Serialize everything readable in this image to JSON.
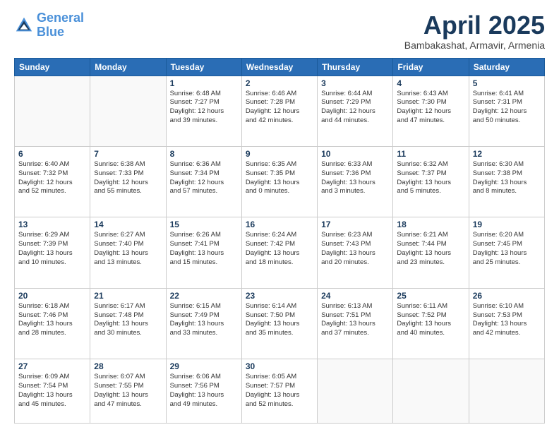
{
  "header": {
    "logo_line1": "General",
    "logo_line2": "Blue",
    "month": "April 2025",
    "location": "Bambakashat, Armavir, Armenia"
  },
  "weekdays": [
    "Sunday",
    "Monday",
    "Tuesday",
    "Wednesday",
    "Thursday",
    "Friday",
    "Saturday"
  ],
  "weeks": [
    [
      {
        "day": "",
        "text": ""
      },
      {
        "day": "",
        "text": ""
      },
      {
        "day": "1",
        "text": "Sunrise: 6:48 AM\nSunset: 7:27 PM\nDaylight: 12 hours\nand 39 minutes."
      },
      {
        "day": "2",
        "text": "Sunrise: 6:46 AM\nSunset: 7:28 PM\nDaylight: 12 hours\nand 42 minutes."
      },
      {
        "day": "3",
        "text": "Sunrise: 6:44 AM\nSunset: 7:29 PM\nDaylight: 12 hours\nand 44 minutes."
      },
      {
        "day": "4",
        "text": "Sunrise: 6:43 AM\nSunset: 7:30 PM\nDaylight: 12 hours\nand 47 minutes."
      },
      {
        "day": "5",
        "text": "Sunrise: 6:41 AM\nSunset: 7:31 PM\nDaylight: 12 hours\nand 50 minutes."
      }
    ],
    [
      {
        "day": "6",
        "text": "Sunrise: 6:40 AM\nSunset: 7:32 PM\nDaylight: 12 hours\nand 52 minutes."
      },
      {
        "day": "7",
        "text": "Sunrise: 6:38 AM\nSunset: 7:33 PM\nDaylight: 12 hours\nand 55 minutes."
      },
      {
        "day": "8",
        "text": "Sunrise: 6:36 AM\nSunset: 7:34 PM\nDaylight: 12 hours\nand 57 minutes."
      },
      {
        "day": "9",
        "text": "Sunrise: 6:35 AM\nSunset: 7:35 PM\nDaylight: 13 hours\nand 0 minutes."
      },
      {
        "day": "10",
        "text": "Sunrise: 6:33 AM\nSunset: 7:36 PM\nDaylight: 13 hours\nand 3 minutes."
      },
      {
        "day": "11",
        "text": "Sunrise: 6:32 AM\nSunset: 7:37 PM\nDaylight: 13 hours\nand 5 minutes."
      },
      {
        "day": "12",
        "text": "Sunrise: 6:30 AM\nSunset: 7:38 PM\nDaylight: 13 hours\nand 8 minutes."
      }
    ],
    [
      {
        "day": "13",
        "text": "Sunrise: 6:29 AM\nSunset: 7:39 PM\nDaylight: 13 hours\nand 10 minutes."
      },
      {
        "day": "14",
        "text": "Sunrise: 6:27 AM\nSunset: 7:40 PM\nDaylight: 13 hours\nand 13 minutes."
      },
      {
        "day": "15",
        "text": "Sunrise: 6:26 AM\nSunset: 7:41 PM\nDaylight: 13 hours\nand 15 minutes."
      },
      {
        "day": "16",
        "text": "Sunrise: 6:24 AM\nSunset: 7:42 PM\nDaylight: 13 hours\nand 18 minutes."
      },
      {
        "day": "17",
        "text": "Sunrise: 6:23 AM\nSunset: 7:43 PM\nDaylight: 13 hours\nand 20 minutes."
      },
      {
        "day": "18",
        "text": "Sunrise: 6:21 AM\nSunset: 7:44 PM\nDaylight: 13 hours\nand 23 minutes."
      },
      {
        "day": "19",
        "text": "Sunrise: 6:20 AM\nSunset: 7:45 PM\nDaylight: 13 hours\nand 25 minutes."
      }
    ],
    [
      {
        "day": "20",
        "text": "Sunrise: 6:18 AM\nSunset: 7:46 PM\nDaylight: 13 hours\nand 28 minutes."
      },
      {
        "day": "21",
        "text": "Sunrise: 6:17 AM\nSunset: 7:48 PM\nDaylight: 13 hours\nand 30 minutes."
      },
      {
        "day": "22",
        "text": "Sunrise: 6:15 AM\nSunset: 7:49 PM\nDaylight: 13 hours\nand 33 minutes."
      },
      {
        "day": "23",
        "text": "Sunrise: 6:14 AM\nSunset: 7:50 PM\nDaylight: 13 hours\nand 35 minutes."
      },
      {
        "day": "24",
        "text": "Sunrise: 6:13 AM\nSunset: 7:51 PM\nDaylight: 13 hours\nand 37 minutes."
      },
      {
        "day": "25",
        "text": "Sunrise: 6:11 AM\nSunset: 7:52 PM\nDaylight: 13 hours\nand 40 minutes."
      },
      {
        "day": "26",
        "text": "Sunrise: 6:10 AM\nSunset: 7:53 PM\nDaylight: 13 hours\nand 42 minutes."
      }
    ],
    [
      {
        "day": "27",
        "text": "Sunrise: 6:09 AM\nSunset: 7:54 PM\nDaylight: 13 hours\nand 45 minutes."
      },
      {
        "day": "28",
        "text": "Sunrise: 6:07 AM\nSunset: 7:55 PM\nDaylight: 13 hours\nand 47 minutes."
      },
      {
        "day": "29",
        "text": "Sunrise: 6:06 AM\nSunset: 7:56 PM\nDaylight: 13 hours\nand 49 minutes."
      },
      {
        "day": "30",
        "text": "Sunrise: 6:05 AM\nSunset: 7:57 PM\nDaylight: 13 hours\nand 52 minutes."
      },
      {
        "day": "",
        "text": ""
      },
      {
        "day": "",
        "text": ""
      },
      {
        "day": "",
        "text": ""
      }
    ]
  ]
}
